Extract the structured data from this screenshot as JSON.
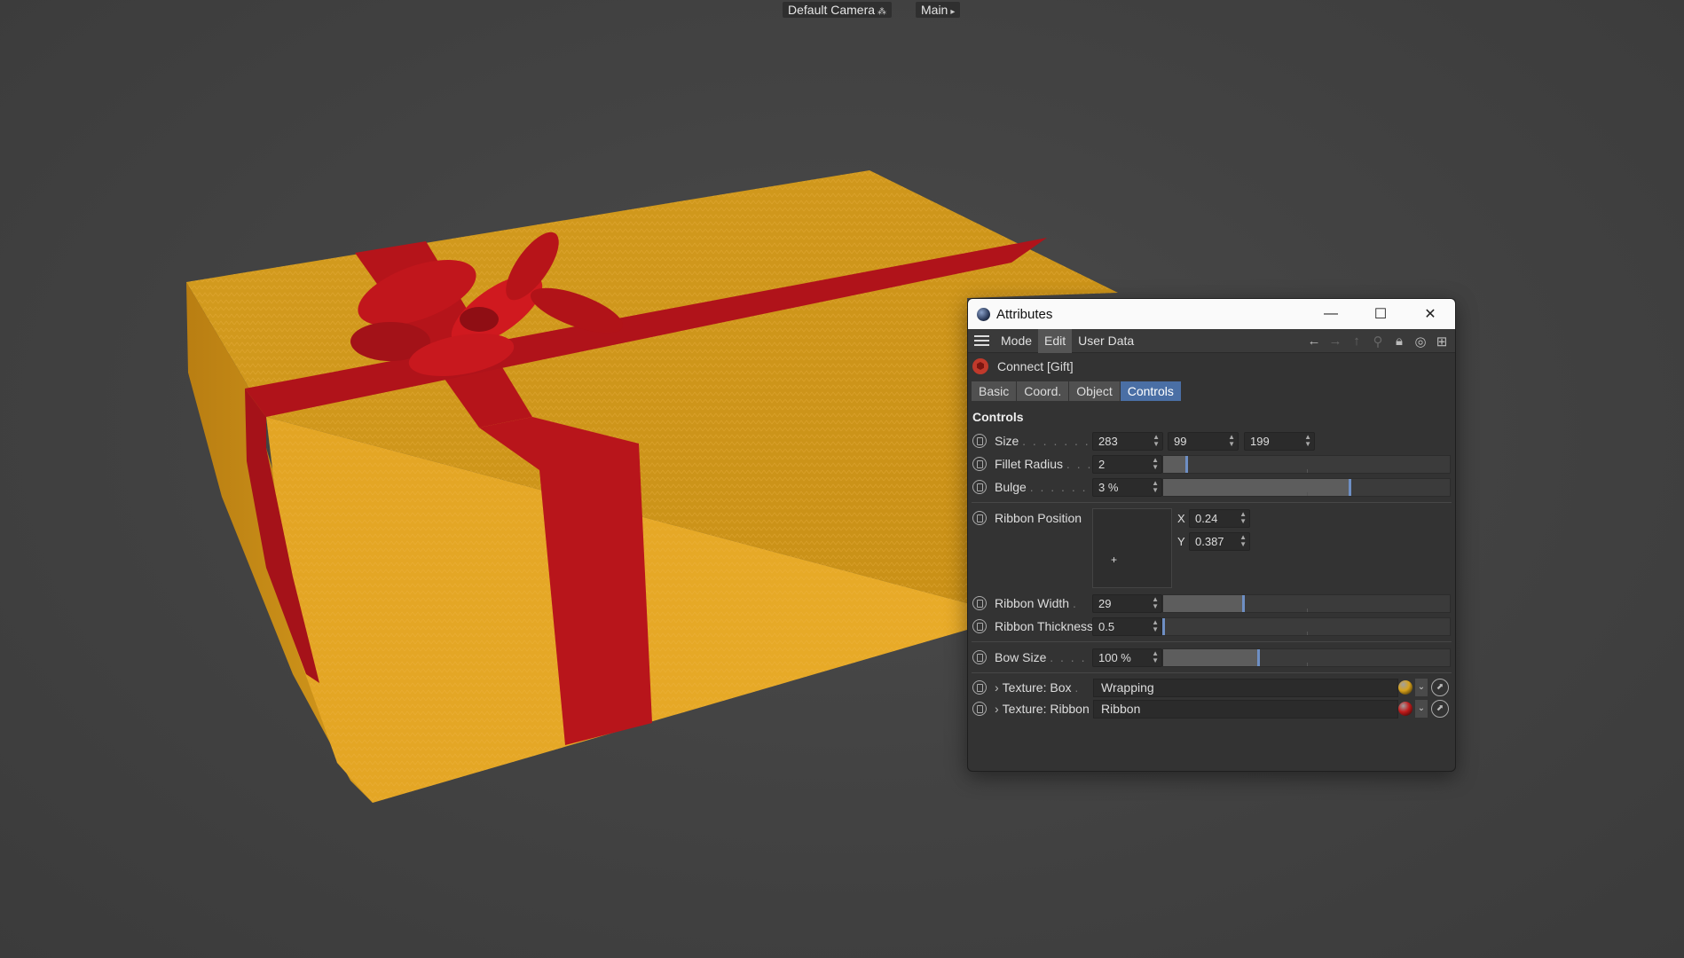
{
  "viewport": {
    "camera_label": "Default Camera",
    "view_label": "Main"
  },
  "window": {
    "title": "Attributes",
    "menu": [
      "Mode",
      "Edit",
      "User Data"
    ],
    "active_menu": "Edit",
    "object_name": "Connect [Gift]",
    "tabs": [
      "Basic",
      "Coord.",
      "Object",
      "Controls"
    ],
    "active_tab": "Controls",
    "section": "Controls",
    "size": {
      "label": "Size",
      "x": "283",
      "y": "99",
      "z": "199"
    },
    "fillet": {
      "label": "Fillet Radius",
      "value": "2",
      "slider": 0.08
    },
    "bulge": {
      "label": "Bulge",
      "value": "3 %",
      "slider": 0.65
    },
    "ribbon_position": {
      "label": "Ribbon Position",
      "x_label": "X",
      "x": "0.24",
      "y_label": "Y",
      "y": "0.387"
    },
    "ribbon_width": {
      "label": "Ribbon Width",
      "value": "29",
      "slider": 0.28
    },
    "ribbon_thickness": {
      "label": "Ribbon Thickness",
      "value": "0.5",
      "slider": 0.0
    },
    "bow_size": {
      "label": "Bow Size",
      "value": "100 %",
      "slider": 0.33
    },
    "texture_box": {
      "label": "Texture: Box",
      "value": "Wrapping",
      "color": "#d7a11a"
    },
    "texture_ribbon": {
      "label": "Texture: Ribbon",
      "value": "Ribbon",
      "color": "#c21a1a"
    }
  }
}
